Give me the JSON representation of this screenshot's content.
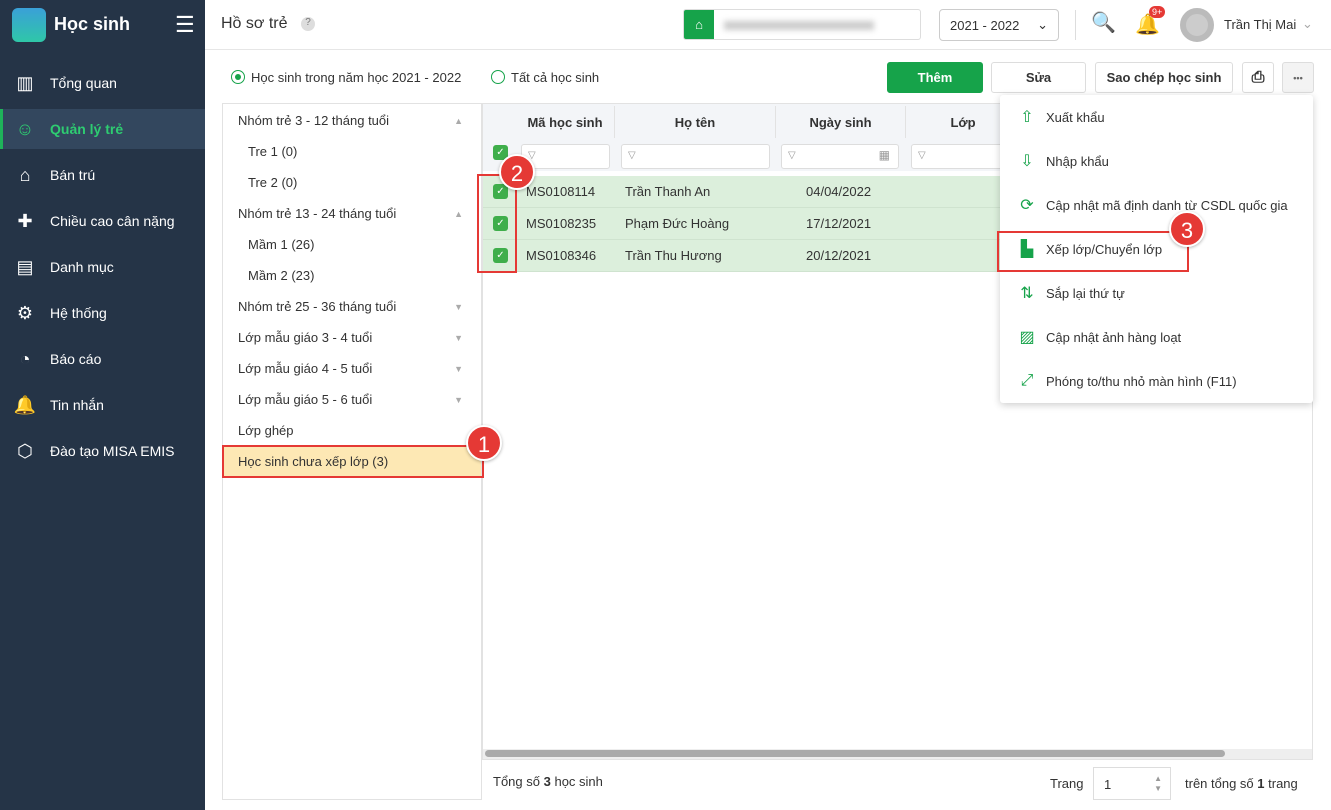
{
  "app": {
    "name": "Học sinh"
  },
  "sidebar": {
    "items": [
      {
        "label": "Tổng quan",
        "icon": "chart-icon"
      },
      {
        "label": "Quản lý trẻ",
        "icon": "child-icon",
        "active": true
      },
      {
        "label": "Bán trú",
        "icon": "home-icon"
      },
      {
        "label": "Chiều cao cân nặng",
        "icon": "medical-icon"
      },
      {
        "label": "Danh mục",
        "icon": "folder-icon"
      },
      {
        "label": "Hệ thống",
        "icon": "gear-icon"
      },
      {
        "label": "Báo cáo",
        "icon": "pie-icon"
      },
      {
        "label": "Tin nhắn",
        "icon": "bell-icon"
      },
      {
        "label": "Đào tạo MISA EMIS",
        "icon": "box-icon"
      }
    ]
  },
  "header": {
    "title": "Hồ sơ trẻ",
    "help": "?",
    "year": "2021 - 2022",
    "notif_badge": "9+",
    "user": "Trần Thị Mai"
  },
  "filters": {
    "radio_current": "Học sinh trong năm học 2021 - 2022",
    "radio_all": "Tất cả học sinh"
  },
  "toolbar": {
    "add": "Thêm",
    "edit": "Sửa",
    "copy": "Sao chép học sinh",
    "more": "•••"
  },
  "tree": [
    {
      "label": "Nhóm trẻ 3 - 12 tháng tuổi",
      "caret": "▲"
    },
    {
      "label": "Tre 1 (0)",
      "sub": true
    },
    {
      "label": "Tre 2 (0)",
      "sub": true
    },
    {
      "label": "Nhóm trẻ 13 - 24 tháng tuổi",
      "caret": "▲"
    },
    {
      "label": "Mầm 1 (26)",
      "sub": true
    },
    {
      "label": "Mầm 2 (23)",
      "sub": true
    },
    {
      "label": "Nhóm trẻ 25 - 36 tháng tuổi",
      "caret": "▼"
    },
    {
      "label": "Lớp mẫu giáo 3 - 4 tuổi",
      "caret": "▼"
    },
    {
      "label": "Lớp mẫu giáo 4 - 5 tuổi",
      "caret": "▼"
    },
    {
      "label": "Lớp mẫu giáo 5 - 6 tuổi",
      "caret": "▼"
    },
    {
      "label": "Lớp ghép"
    },
    {
      "label": "Học sinh chưa xếp lớp (3)",
      "selected": true
    }
  ],
  "grid": {
    "columns": [
      "Mã học sinh",
      "Họ tên",
      "Ngày sinh",
      "Lớp"
    ],
    "rows": [
      {
        "id": "MS0108114",
        "name": "Trần Thanh An",
        "dob": "04/04/2022",
        "checked": true
      },
      {
        "id": "MS0108235",
        "name": "Phạm Đức Hoàng",
        "dob": "17/12/2021",
        "checked": true
      },
      {
        "id": "MS0108346",
        "name": "Trần Thu Hương",
        "dob": "20/12/2021",
        "checked": true
      }
    ]
  },
  "footer": {
    "total_prefix": "Tổng số",
    "total": "3",
    "total_suffix": "học sinh",
    "page_label": "Trang",
    "page": "1",
    "of_prefix": "trên tổng số",
    "pages": "1",
    "of_suffix": "trang"
  },
  "menu": [
    {
      "label": "Xuất khẩu",
      "icon": "upload-icon"
    },
    {
      "label": "Nhập khẩu",
      "icon": "download-icon"
    },
    {
      "label": "Cập nhật mã định danh từ CSDL quốc gia",
      "icon": "sync-icon"
    },
    {
      "label": "Xếp lớp/Chuyển lớp",
      "icon": "building-icon"
    },
    {
      "label": "Sắp lại thứ tự",
      "icon": "sort-az-icon"
    },
    {
      "label": "Cập nhật ảnh hàng loạt",
      "icon": "images-icon"
    },
    {
      "label": "Phóng to/thu nhỏ màn hình (F11)",
      "icon": "expand-icon"
    }
  ],
  "annotations": [
    "1",
    "2",
    "3"
  ],
  "colors": {
    "sidebar": "#253447",
    "accent": "#16a34a",
    "selected_row": "#dcefdc",
    "annotation": "#e53935"
  }
}
